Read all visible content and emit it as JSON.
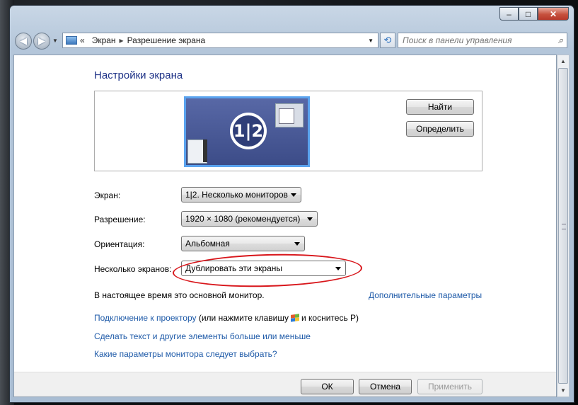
{
  "window": {
    "controls": {
      "minimize": "–",
      "maximize": "□",
      "close": "✕"
    }
  },
  "nav": {
    "breadcrumb": [
      "Экран",
      "Разрешение экрана"
    ],
    "search_placeholder": "Поиск в панели управления"
  },
  "main": {
    "heading": "Настройки экрана",
    "monitor_badge": "1|2",
    "find_button": "Найти",
    "identify_button": "Определить",
    "fields": {
      "screen": {
        "label": "Экран:",
        "value": "1|2. Несколько мониторов"
      },
      "resolution": {
        "label": "Разрешение:",
        "value": "1920 × 1080 (рекомендуется)"
      },
      "orientation": {
        "label": "Ориентация:",
        "value": "Альбомная"
      },
      "multiple": {
        "label": "Несколько экранов:",
        "value": "Дублировать эти экраны"
      }
    },
    "status_text": "В настоящее время это основной монитор.",
    "advanced_link": "Дополнительные параметры",
    "projector_link": "Подключение к проектору",
    "projector_hint_pre": "(или нажмите клавишу",
    "projector_hint_post": "и коснитесь P)",
    "text_size_link": "Сделать текст и другие элементы больше или меньше",
    "which_settings_link": "Какие параметры монитора следует выбрать?"
  },
  "footer": {
    "ok": "ОК",
    "cancel": "Отмена",
    "apply": "Применить"
  },
  "colors": {
    "link": "#1e5aa8",
    "heading": "#1e3287",
    "annotation": "#d8161b",
    "monitor_border": "#5aa3ee"
  }
}
